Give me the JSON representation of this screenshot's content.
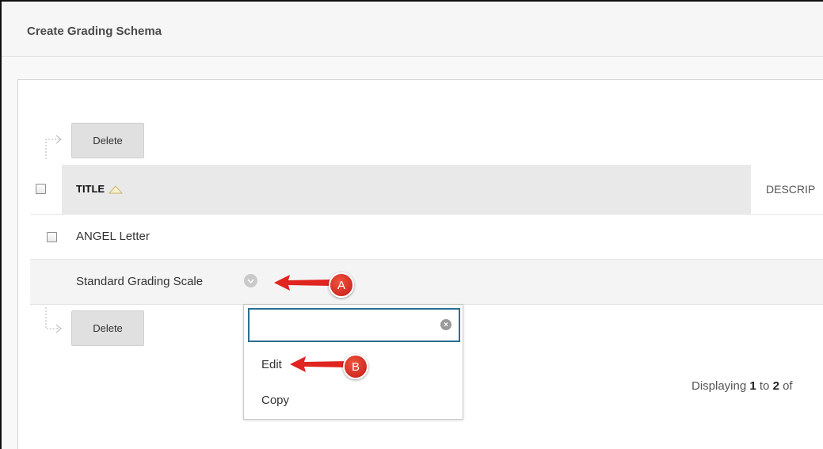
{
  "header": {
    "title": "Create Grading Schema"
  },
  "actions": {
    "delete_top": "Delete",
    "delete_bottom": "Delete"
  },
  "table": {
    "columns": {
      "title": "TITLE",
      "description": "DESCRIP"
    },
    "rows": [
      {
        "title": "ANGEL Letter"
      },
      {
        "title": "Standard Grading Scale"
      }
    ]
  },
  "context_menu": {
    "search_value": "",
    "items": [
      "Edit",
      "Copy"
    ]
  },
  "pager": {
    "prefix": "Displaying",
    "start": "1",
    "to": "to",
    "end": "2",
    "suffix": "of"
  },
  "callouts": {
    "a": "A",
    "b": "B"
  },
  "colors": {
    "callout": "#e02420",
    "search_border": "#2a6f94"
  }
}
